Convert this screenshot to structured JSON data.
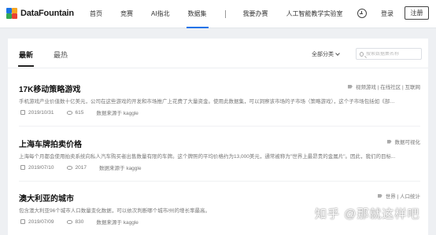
{
  "brand": {
    "name": "DataFountain"
  },
  "nav": {
    "items": [
      "首页",
      "竞赛",
      "AI指北",
      "数据集",
      "我要办赛",
      "人工智能教学实验室"
    ],
    "active": "数据集"
  },
  "auth": {
    "login": "登录",
    "register": "注册"
  },
  "tabs": {
    "latest": "最新",
    "hottest": "最热"
  },
  "filter": {
    "label": "全部分类"
  },
  "search": {
    "placeholder": "搜索数据集名称"
  },
  "datasets": [
    {
      "title": "17K移动策略游戏",
      "tags": "视频游戏 | 在线社区 | 互联网",
      "description": "手机游戏产业价值数十亿美元，公司在这些游戏的开发和市场推广上花费了大量资金。使用此数据集，可以洞察该市场的子市场（策略游戏），这个子市场包括如《部落...",
      "date": "2019/10/31",
      "views": "615",
      "source": "数据来源于 kaggle"
    },
    {
      "title": "上海车牌拍卖价格",
      "tags": "数据可视化",
      "description": "上海每个月都会使用拍卖系统向私人汽车购买者出售数量有限的车牌。这个牌照的平均价格约为13,000美元，通常被称为\"世界上最昂贵的金属片\"。因此，我们的目标...",
      "date": "2019/07/10",
      "views": "2017",
      "source": "数据来源于 kaggle"
    },
    {
      "title": "澳大利亚的城市",
      "tags": "世界 | 人口统计",
      "description": "包含澳大利亚96个城市人口数量变化数据，可以依次判断哪个城市/州的增长率最高。",
      "date": "2019/07/09",
      "views": "830",
      "source": "数据来源于 kaggle"
    }
  ],
  "watermark": "知乎 @那就这样吧",
  "colors": {
    "accent": "#1a73e8",
    "logo": [
      "#1a73e8",
      "#f5a623",
      "#34a853",
      "#e94235"
    ]
  }
}
